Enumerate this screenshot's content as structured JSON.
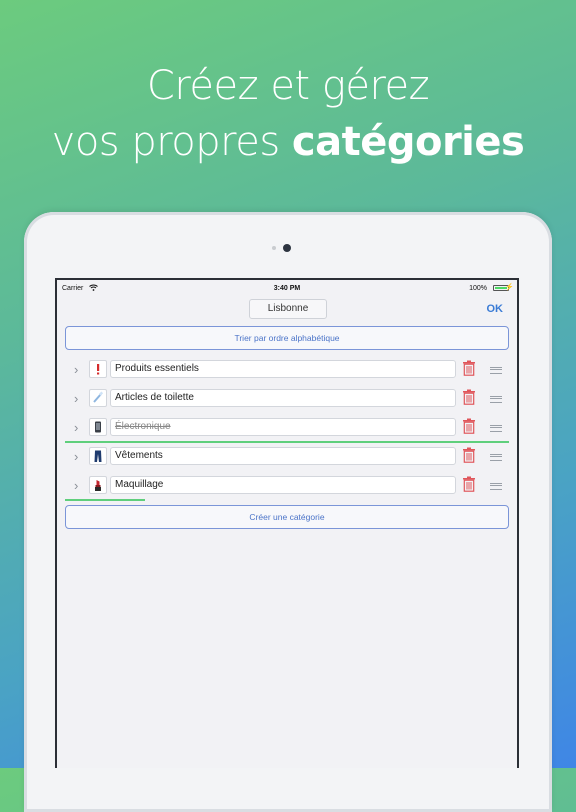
{
  "headline": {
    "line1": "Créez et gérez",
    "line2_prefix": "vos propres ",
    "line2_bold": "catégories"
  },
  "status_bar": {
    "carrier": "Carrier",
    "time": "3:40 PM",
    "battery_pct": "100%"
  },
  "nav": {
    "title_value": "Lisbonne",
    "ok_label": "OK"
  },
  "sort_label": "Trier par ordre alphabétique",
  "create_label": "Créer une catégorie",
  "categories": [
    {
      "label": "Produits essentiels",
      "icon": "exclamation-icon",
      "struck": false
    },
    {
      "label": "Articles de toilette",
      "icon": "toothbrush-icon",
      "struck": false
    },
    {
      "label": "Électronique",
      "icon": "phone-icon",
      "struck": true,
      "progress": 1.0
    },
    {
      "label": "Vêtements",
      "icon": "jeans-icon",
      "struck": false
    },
    {
      "label": "Maquillage",
      "icon": "lipstick-icon",
      "struck": false,
      "progress": 0.18
    }
  ],
  "colors": {
    "accent": "#3a7bd5",
    "delete": "#e0565b",
    "progress": "#5fcf7c"
  }
}
